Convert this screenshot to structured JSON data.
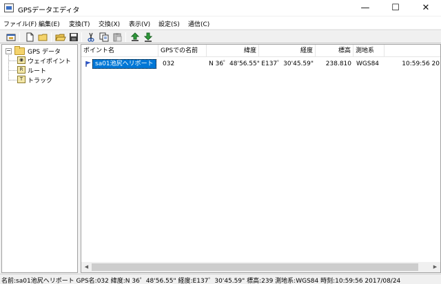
{
  "window": {
    "title": "GPSデータエディタ",
    "minimize_glyph": "—",
    "maximize_glyph": "☐",
    "close_glyph": "✕"
  },
  "menu": [
    "ファイル(F)",
    "編集(E)",
    "変換(T)",
    "交換(X)",
    "表示(V)",
    "設定(S)",
    "通信(C)"
  ],
  "toolbar": [
    "new-window-icon",
    "new-file-icon",
    "new-folder-icon",
    "open-folder-icon",
    "save-icon",
    "cut-icon",
    "copy-icon",
    "paste-icon",
    "upload-icon",
    "download-icon"
  ],
  "tree": {
    "toggle": "−",
    "root": "GPS データ",
    "children": [
      {
        "label": "ウェイポイント",
        "icon": "waypoint-icon"
      },
      {
        "label": "ルート",
        "icon": "route-icon"
      },
      {
        "label": "トラック",
        "icon": "track-icon"
      }
    ]
  },
  "list": {
    "columns": [
      "ポイント名",
      "GPSでの名前",
      "緯度",
      "経度",
      "標高",
      "測地系",
      ""
    ],
    "rows": [
      {
        "name": "sa01池尻ヘリポート",
        "gps_name": "032",
        "lat": "N 36゜48'56.55\"",
        "lon": "E137゜30'45.59\"",
        "elev": "238.810",
        "datum": "WGS84",
        "time": "10:59:56 20"
      }
    ]
  },
  "scrollbar": {
    "left": "◀",
    "right": "▶"
  },
  "status": "名前:sa01池尻ヘリポート GPS名:032 緯度:N 36゜48'56.55\" 経度:E137゜30'45.59\" 標高:239 測地系:WGS84 時刻:10:59:56 2017/08/24",
  "colors": {
    "selection": "#0078d7",
    "folder": "#f4d36b"
  }
}
